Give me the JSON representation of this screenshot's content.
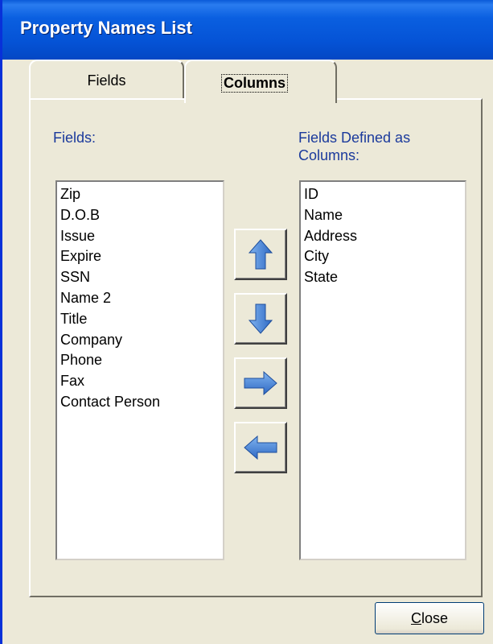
{
  "window": {
    "title": "Property Names List"
  },
  "tabs": [
    {
      "label": "Fields",
      "active": false
    },
    {
      "label": "Columns",
      "active": true
    }
  ],
  "left_list": {
    "label": "Fields:",
    "items": [
      "Zip",
      "D.O.B",
      "Issue",
      "Expire",
      "SSN",
      "Name 2",
      "Title",
      "Company",
      "Phone",
      "Fax",
      "Contact Person"
    ]
  },
  "right_list": {
    "label_line1": "Fields Defined as",
    "label_line2": "Columns:",
    "items": [
      "ID",
      "Name",
      "Address",
      "City",
      "State"
    ]
  },
  "buttons": {
    "move_up": "up-arrow-icon",
    "move_down": "down-arrow-icon",
    "add": "right-arrow-icon",
    "remove": "left-arrow-icon",
    "close_mnemonic": "C",
    "close_rest": "lose"
  },
  "colors": {
    "titlebar": "#0553d6",
    "label_blue": "#1b3a9c",
    "arrow_blue": "#3a7fd5"
  }
}
